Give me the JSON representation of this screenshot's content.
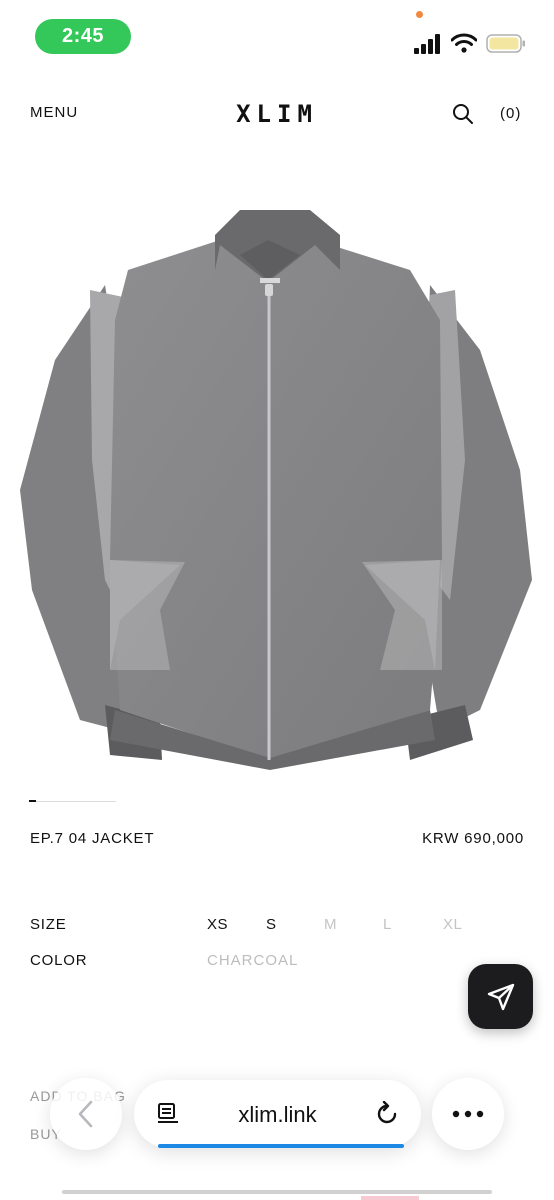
{
  "status_bar": {
    "time": "2:45",
    "time_bg": "#34c759",
    "icons": [
      "cellular-signal-icon",
      "wifi-icon",
      "battery-icon"
    ]
  },
  "header": {
    "menu_label": "MENU",
    "brand": "XLIM",
    "cart_label": "(0)",
    "search_icon": "search-icon"
  },
  "product": {
    "name": "EP.7 04 JACKET",
    "price": "KRW 690,000",
    "image_alt": "grey zip-up jacket",
    "gallery_position": 1
  },
  "options": {
    "size_label": "SIZE",
    "sizes": [
      {
        "label": "XS",
        "available": true
      },
      {
        "label": "S",
        "available": true
      },
      {
        "label": "M",
        "available": false
      },
      {
        "label": "L",
        "available": false
      },
      {
        "label": "XL",
        "available": false
      }
    ],
    "color_label": "COLOR",
    "color_value": "CHARCOAL"
  },
  "actions": {
    "add_to_bag": "ADD TO BAG",
    "buy_now": "BUY"
  },
  "share_icon": "send-arrow-icon",
  "browser": {
    "url": "xlim.link",
    "reader_icon": "reader-mode-icon",
    "reload_icon": "reload-icon",
    "back_icon": "chevron-left-icon",
    "more_icon": "more-dots-icon",
    "accent": "#1e88e5"
  }
}
